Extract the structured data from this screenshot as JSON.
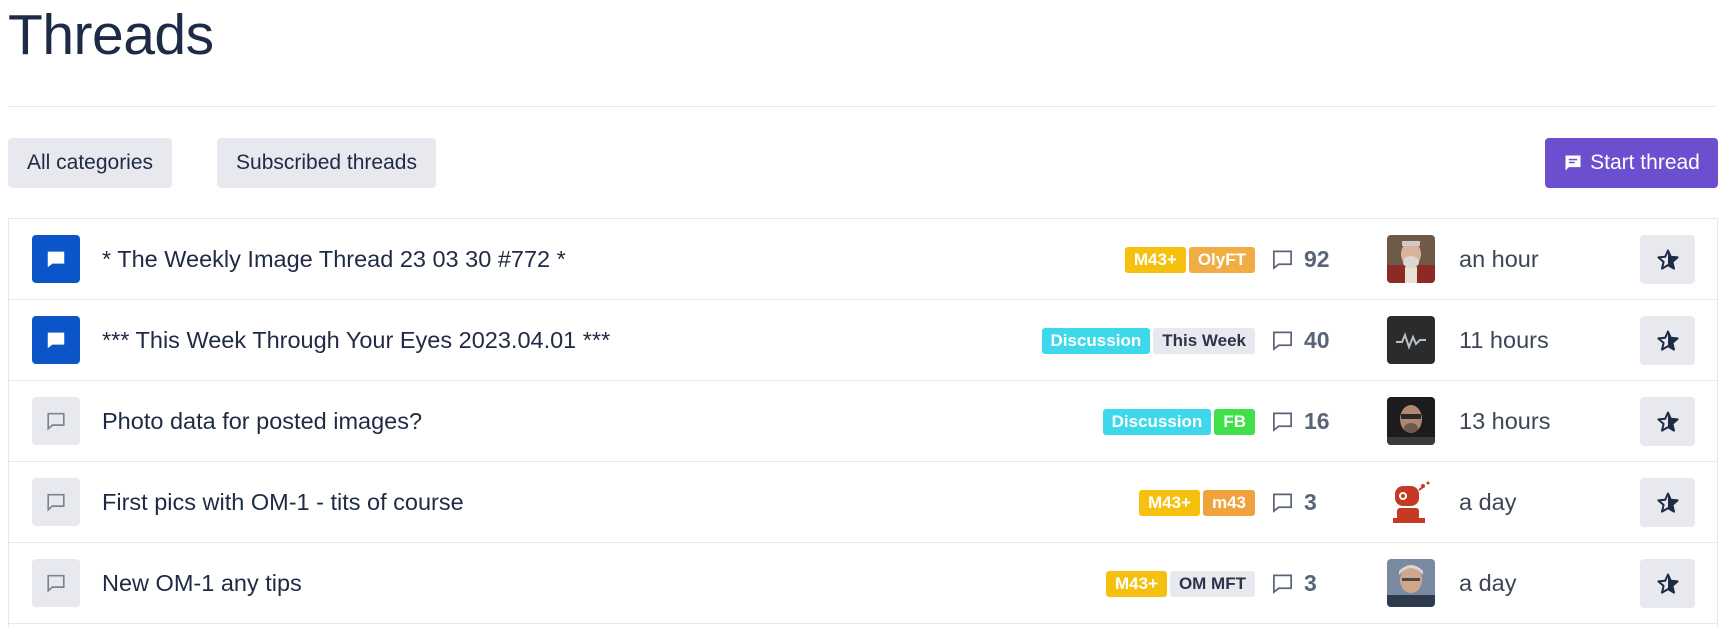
{
  "page": {
    "title": "Threads"
  },
  "toolbar": {
    "all_categories": "All categories",
    "subscribed_threads": "Subscribed threads",
    "start_thread": "Start thread",
    "accent_color": "#6b4fcf"
  },
  "threads": [
    {
      "title": "* The Weekly Image Thread 23 03 30 #772 *",
      "active": true,
      "tags": [
        {
          "label": "M43+",
          "color": "#f6c10e"
        },
        {
          "label": "OlyFT",
          "color": "#f0ad44"
        }
      ],
      "replies": "92",
      "last_activity": "an hour",
      "avatar": "avatar-photo-bearded-man"
    },
    {
      "title": "*** This Week Through Your Eyes 2023.04.01 ***",
      "active": true,
      "tags": [
        {
          "label": "Discussion",
          "color": "#3dd9ea"
        },
        {
          "label": "This Week",
          "color": "#e8e9ee",
          "text_color": "#2b3448"
        }
      ],
      "replies": "40",
      "last_activity": "11 hours",
      "avatar": "avatar-waveform"
    },
    {
      "title": "Photo data for posted images?",
      "active": false,
      "tags": [
        {
          "label": "Discussion",
          "color": "#3dd9ea"
        },
        {
          "label": "FB",
          "color": "#3fe04a"
        }
      ],
      "replies": "16",
      "last_activity": "13 hours",
      "avatar": "avatar-photo-man-glasses"
    },
    {
      "title": "First pics with OM-1 - tits of course",
      "active": false,
      "tags": [
        {
          "label": "M43+",
          "color": "#f6c10e"
        },
        {
          "label": "m43",
          "color": "#f0a33c"
        }
      ],
      "replies": "3",
      "last_activity": "a day",
      "avatar": "avatar-red-robot"
    },
    {
      "title": "New OM-1 any tips",
      "active": false,
      "tags": [
        {
          "label": "M43+",
          "color": "#f6c10e"
        },
        {
          "label": "OM MFT",
          "color": "#e8e9ee",
          "text_color": "#2b3448"
        }
      ],
      "replies": "3",
      "last_activity": "a day",
      "avatar": "avatar-photo-grey-hair-man"
    }
  ]
}
